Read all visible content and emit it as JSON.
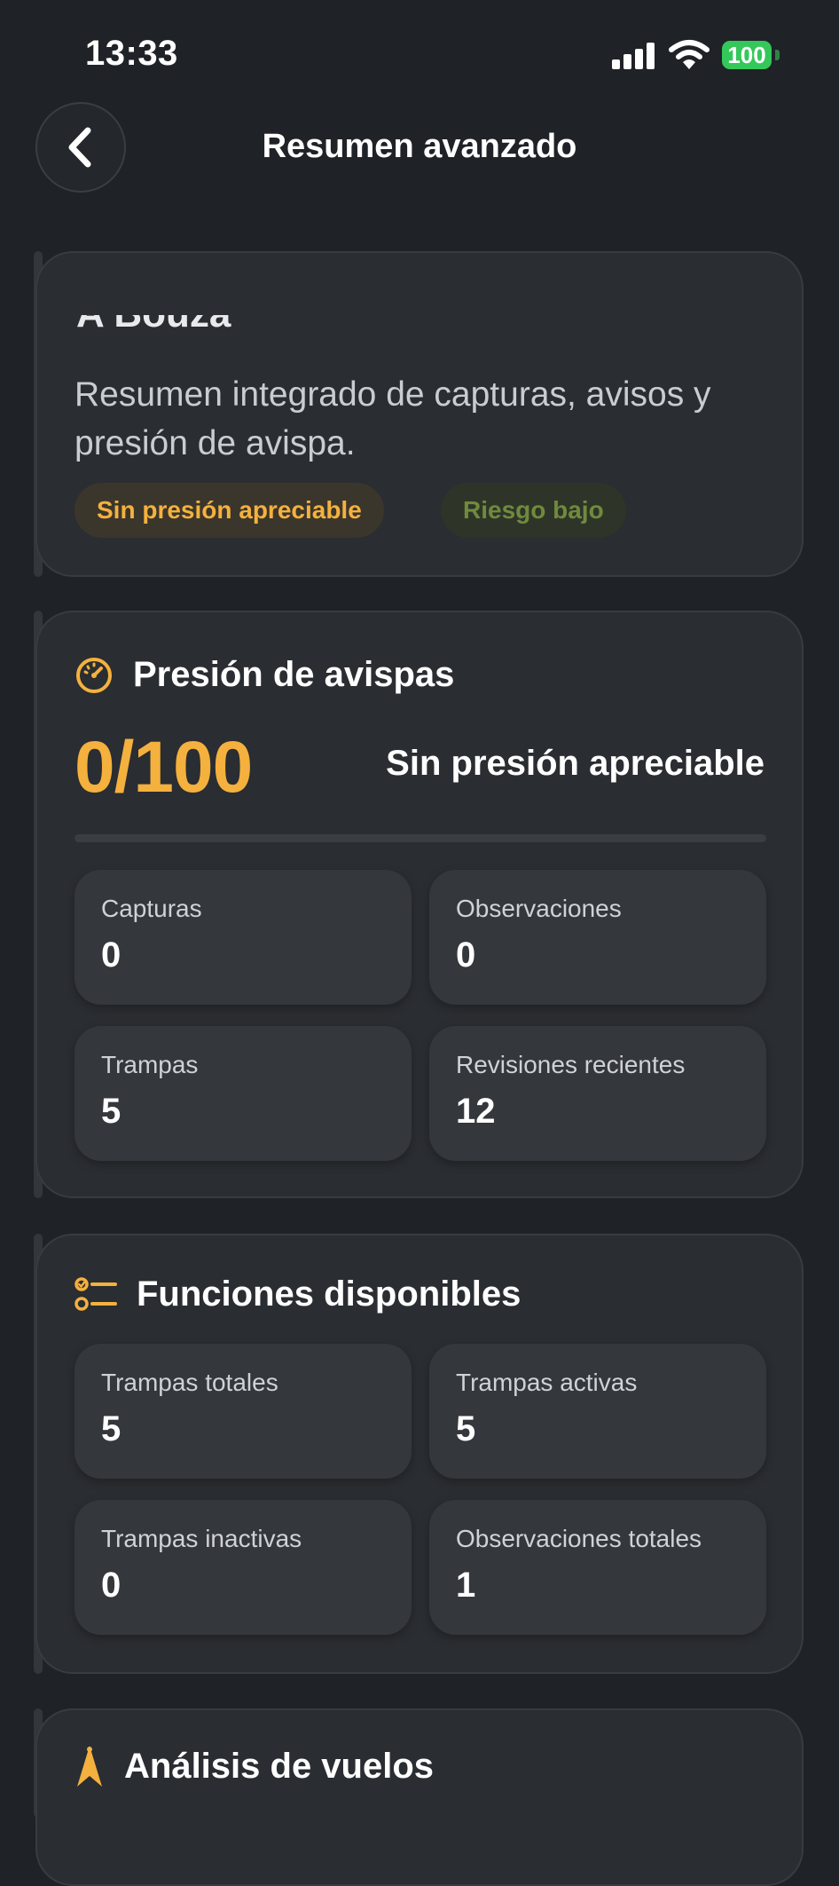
{
  "status_bar": {
    "time": "13:33",
    "battery": "100"
  },
  "header": {
    "title": "Resumen avanzado"
  },
  "intro_card": {
    "partial_title": "A Bouza",
    "description": "Resumen integrado de capturas, avisos y presión de avispa.",
    "chips": {
      "pressure": "Sin presión apreciable",
      "risk": "Riesgo bajo"
    }
  },
  "pressure_card": {
    "title": "Presión de avispas",
    "score": "0/100",
    "score_label": "Sin presión apreciable",
    "progress_percent": 0,
    "stats": [
      {
        "label": "Capturas",
        "value": "0"
      },
      {
        "label": "Observaciones",
        "value": "0"
      },
      {
        "label": "Trampas",
        "value": "5"
      },
      {
        "label": "Revisiones recientes",
        "value": "12"
      }
    ]
  },
  "functions_card": {
    "title": "Funciones disponibles",
    "stats": [
      {
        "label": "Trampas totales",
        "value": "5"
      },
      {
        "label": "Trampas activas",
        "value": "5"
      },
      {
        "label": "Trampas inactivas",
        "value": "0"
      },
      {
        "label": "Observaciones totales",
        "value": "1"
      }
    ]
  },
  "flights_card": {
    "title": "Análisis de vuelos"
  },
  "colors": {
    "accent": "#f4b13e",
    "risk_low": "#6f8a3d",
    "background": "#1f2226",
    "card": "#2a2d31",
    "battery": "#34c759"
  },
  "icons": {
    "back": "chevron-left-icon",
    "pressure": "gauge-icon",
    "functions": "checklist-icon",
    "flights": "compass-icon"
  }
}
